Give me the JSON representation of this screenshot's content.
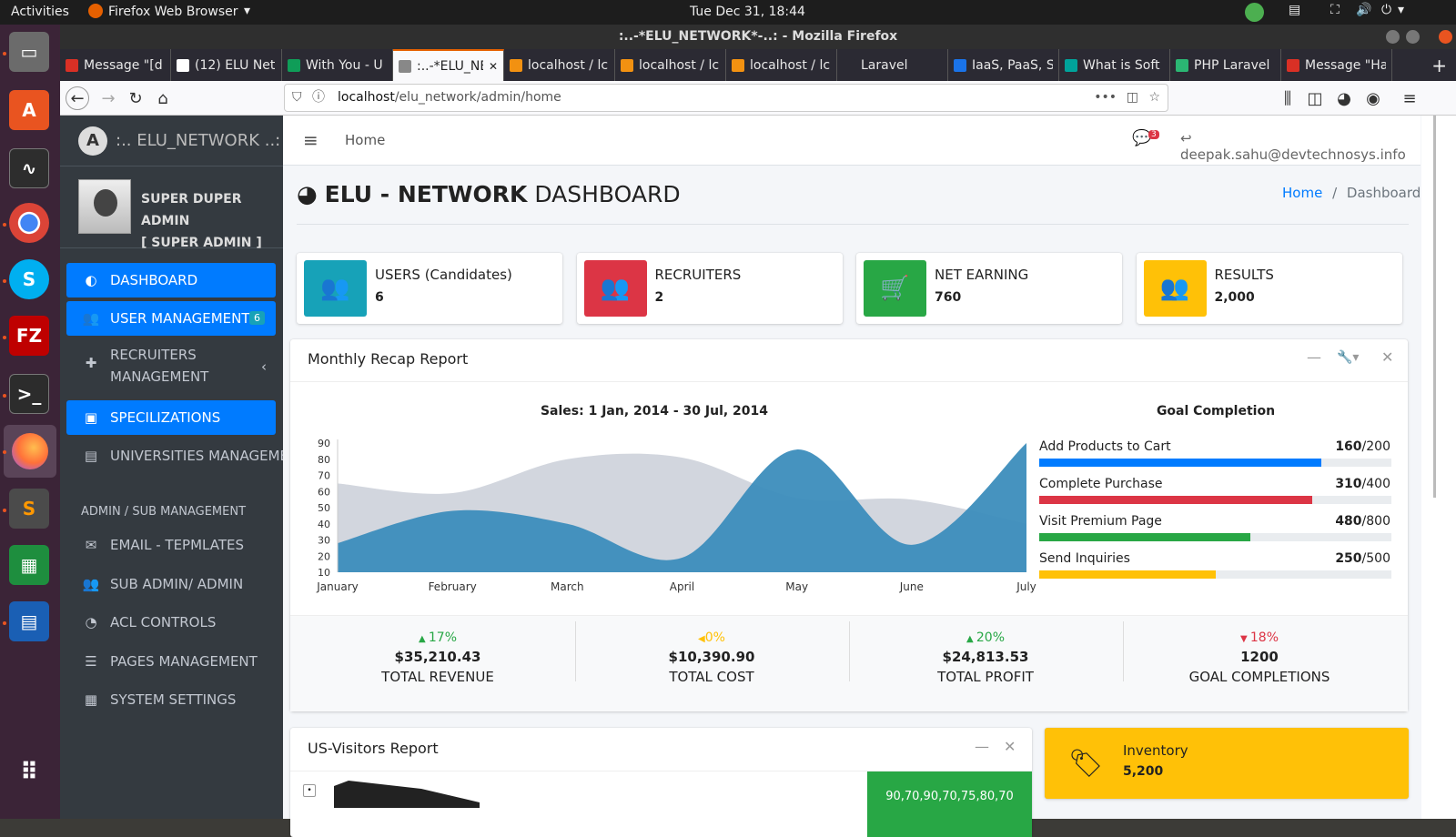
{
  "system": {
    "activities": "Activities",
    "app_menu": "Firefox Web Browser",
    "clock": "Tue Dec 31, 18:44"
  },
  "window": {
    "title": ":..-*ELU_NETWORK*-..: - Mozilla Firefox"
  },
  "tabs": [
    {
      "label": "Message \"[d",
      "color": "#d93025"
    },
    {
      "label": "(12) ELU Net",
      "color": "#fff"
    },
    {
      "label": "With You - U",
      "color": "#0f9d58"
    },
    {
      "label": ":..-*ELU_NET",
      "color": "#888"
    },
    {
      "label": "localhost / lc",
      "color": "#f29111"
    },
    {
      "label": "localhost / lc",
      "color": "#f29111"
    },
    {
      "label": "localhost / lc",
      "color": "#f29111"
    },
    {
      "label": "Laravel",
      "color": "#2b2a33"
    },
    {
      "label": "IaaS, PaaS, S",
      "color": "#1a73e8"
    },
    {
      "label": "What is Soft",
      "color": "#00a39b"
    },
    {
      "label": "PHP Laravel",
      "color": "#2bb673"
    },
    {
      "label": "Message \"Ha",
      "color": "#d93025"
    }
  ],
  "url": {
    "host": "localhost",
    "path": "/elu_network/admin/home"
  },
  "sidebar": {
    "brand": ":.. ELU_NETWORK ..:",
    "brand_logo": "A",
    "user_line1": "SUPER DUPER ADMIN",
    "user_line2": "[ SUPER ADMIN ]",
    "items": [
      {
        "label": "DASHBOARD",
        "icon": "tachometer-icon",
        "glyph": "◐"
      },
      {
        "label": "USER MANAGEMENT",
        "icon": "users-icon",
        "glyph": "👥",
        "badge": "6"
      },
      {
        "label": "RECRUITERS",
        "label2": "MANAGEMENT",
        "icon": "plus-square-icon",
        "glyph": "✚"
      },
      {
        "label": "SPECILIZATIONS",
        "icon": "briefcase-icon",
        "glyph": "▣"
      },
      {
        "label": "UNIVERSITIES MANAGEMENT",
        "icon": "file-icon",
        "glyph": "▤"
      }
    ],
    "section_header": "ADMIN / SUB MANAGEMENT",
    "admin_items": [
      {
        "label": "EMAIL - TEPMLATES",
        "icon": "envelope-icon",
        "glyph": "✉"
      },
      {
        "label": "SUB ADMIN/ ADMIN",
        "icon": "users-icon",
        "glyph": "👥"
      },
      {
        "label": "ACL CONTROLS",
        "icon": "pie-chart-icon",
        "glyph": "◔"
      },
      {
        "label": "PAGES MANAGEMENT",
        "icon": "list-icon",
        "glyph": "☰"
      },
      {
        "label": "SYSTEM SETTINGS",
        "icon": "table-icon",
        "glyph": "▦"
      }
    ]
  },
  "topnav": {
    "home": "Home",
    "notif_count": "3",
    "user_email": "deepak.sahu@devtechnosys.info"
  },
  "page": {
    "title_bold": "ELU - NETWORK",
    "title_rest": "DASHBOARD",
    "breadcrumb_home": "Home",
    "breadcrumb_sep": "/",
    "breadcrumb_current": "Dashboard"
  },
  "info_boxes": [
    {
      "label": "USERS (Candidates)",
      "value": "6",
      "color": "#17a2b8",
      "icon": "users-icon"
    },
    {
      "label": "RECRUITERS",
      "value": "2",
      "color": "#dc3545",
      "icon": "users-icon"
    },
    {
      "label": "NET EARNING",
      "value": "760",
      "color": "#28a745",
      "icon": "cart-icon"
    },
    {
      "label": "RESULTS",
      "value": "2,000",
      "color": "#ffc107",
      "icon": "users-icon"
    }
  ],
  "recap": {
    "title": "Monthly Recap Report",
    "chart_title": "Sales: 1 Jan, 2014 - 30 Jul, 2014",
    "goal_title": "Goal Completion",
    "goals": [
      {
        "label": "Add Products to Cart",
        "num": "160",
        "den": "/200",
        "fraction": 0.8,
        "color": "#007bff"
      },
      {
        "label": "Complete Purchase",
        "num": "310",
        "den": "/400",
        "fraction": 0.775,
        "color": "#dc3545"
      },
      {
        "label": "Visit Premium Page",
        "num": "480",
        "den": "/800",
        "fraction": 0.6,
        "color": "#28a745"
      },
      {
        "label": "Send Inquiries",
        "num": "250",
        "den": "/500",
        "fraction": 0.5,
        "color": "#ffc107"
      }
    ],
    "stats": [
      {
        "pct": "17%",
        "dir": "up",
        "color": "#28a745",
        "amount": "$35,210.43",
        "label": "TOTAL REVENUE"
      },
      {
        "pct": "0%",
        "dir": "flat",
        "color": "#ffc107",
        "amount": "$10,390.90",
        "label": "TOTAL COST"
      },
      {
        "pct": "20%",
        "dir": "up",
        "color": "#28a745",
        "amount": "$24,813.53",
        "label": "TOTAL PROFIT"
      },
      {
        "pct": "18%",
        "dir": "down",
        "color": "#dc3545",
        "amount": "1200",
        "label": "GOAL COMPLETIONS"
      }
    ]
  },
  "visitors": {
    "title": "US-Visitors Report",
    "sparkline": "90,70,90,70,75,80,70"
  },
  "inventory": {
    "label": "Inventory",
    "value": "5,200"
  },
  "chart_data": {
    "type": "area",
    "title": "Sales: 1 Jan, 2014 - 30 Jul, 2014",
    "categories": [
      "January",
      "February",
      "March",
      "April",
      "May",
      "June",
      "July"
    ],
    "ylim": [
      10,
      90
    ],
    "yticks": [
      10,
      20,
      30,
      40,
      50,
      60,
      70,
      80,
      90
    ],
    "series": [
      {
        "values": [
          65,
          59,
          80,
          81,
          56,
          55,
          40
        ],
        "color": "#d2d6de"
      },
      {
        "values": [
          28,
          48,
          40,
          19,
          86,
          27,
          90
        ],
        "color": "#3c8dbc"
      }
    ],
    "grid": false
  }
}
